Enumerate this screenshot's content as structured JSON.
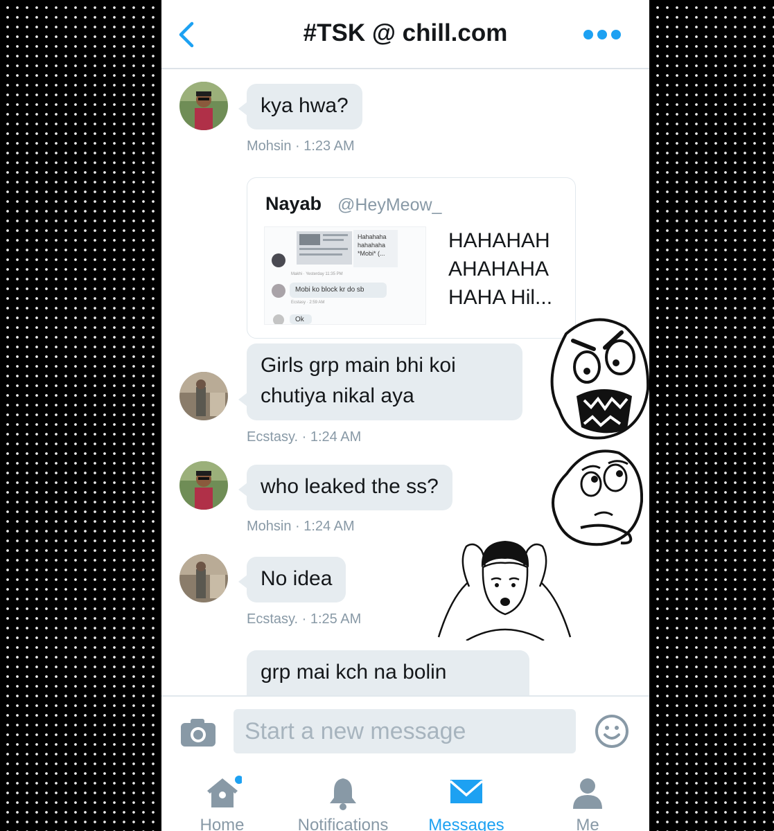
{
  "header": {
    "title": "#TSK @ chill.com"
  },
  "messages": [
    {
      "text": "kya hwa?",
      "meta": "Mohsin · 1:23 AM"
    },
    {
      "text": "Girls grp main bhi koi chutiya nikal aya",
      "meta": "Ecstasy. · 1:24 AM"
    },
    {
      "text": "who leaked the ss?",
      "meta": "Mohsin · 1:24 AM"
    },
    {
      "text": "No idea",
      "meta": "Ecstasy. · 1:25 AM"
    },
    {
      "text": "grp mai kch na bolin"
    }
  ],
  "tweet": {
    "name": "Nayab",
    "handle": "@HeyMeow_",
    "text": "HAHAHAH AHAHAHA HAHA Hil...",
    "thumb": {
      "line1": "Hahahaha",
      "line2": "hahahaha",
      "line3": "*Mobi* (...",
      "meta1": "Makhi · Yesterday 11:35 PM",
      "bubble": "Mobi ko block kr do sb",
      "meta2": "Ecstasy · 2:59 AM",
      "bubble2": "Ok"
    }
  },
  "composer": {
    "placeholder": "Start a new message"
  },
  "tabs": [
    {
      "label": "Home",
      "icon": "home-icon",
      "notification_dot": true
    },
    {
      "label": "Notifications",
      "icon": "bell-icon"
    },
    {
      "label": "Messages",
      "icon": "envelope-icon",
      "active": true
    },
    {
      "label": "Me",
      "icon": "person-icon"
    }
  ],
  "colors": {
    "accent": "#1da1f2",
    "bubble": "#e6ecf0",
    "meta": "#8899a6",
    "text": "#14171a"
  }
}
